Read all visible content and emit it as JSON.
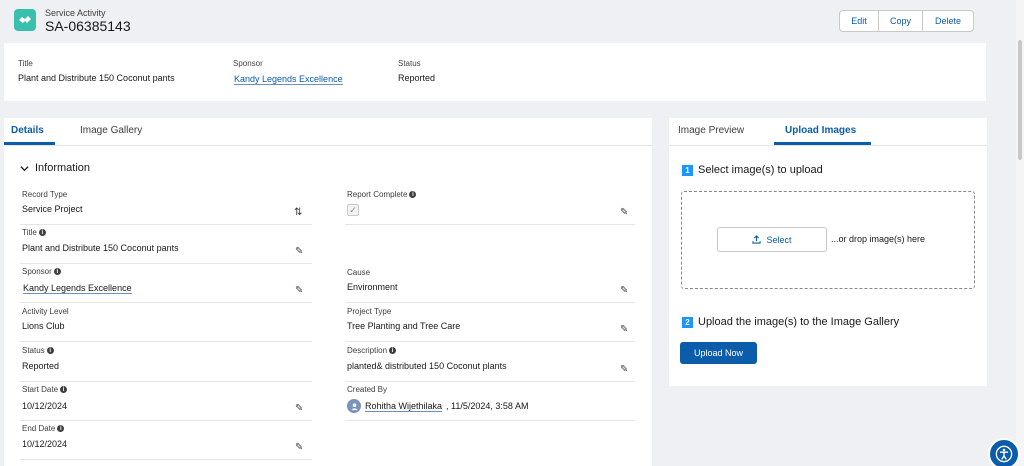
{
  "header": {
    "object_label": "Service Activity",
    "record_name": "SA-06385143",
    "icon": "service-activity-icon",
    "actions": [
      "Edit",
      "Copy",
      "Delete"
    ]
  },
  "highlights": {
    "fields": [
      {
        "label": "Title",
        "value": "Plant and Distribute 150 Coconut pants"
      },
      {
        "label": "Sponsor",
        "value": "Kandy Legends Excellence"
      },
      {
        "label": "Status",
        "value": "Reported"
      }
    ]
  },
  "detail_tabs": [
    "Details",
    "Image Gallery"
  ],
  "section": {
    "title": "Information",
    "left_fields": [
      {
        "label": "Record Type",
        "value": "Service Project"
      },
      {
        "label": "Title",
        "value": "Plant and Distribute 150 Coconut pants"
      },
      {
        "label": "Sponsor",
        "value": "Kandy Legends Excellence"
      },
      {
        "label": "Activity Level",
        "value": "Lions Club"
      },
      {
        "label": "Status",
        "value": "Reported"
      },
      {
        "label": "Start Date",
        "value": "10/12/2024"
      },
      {
        "label": "End Date",
        "value": "10/12/2024"
      }
    ],
    "right_fields": [
      {
        "label": "Report Complete",
        "value": ""
      },
      {
        "label": "Cause",
        "value": "Environment"
      },
      {
        "label": "Project Type",
        "value": "Tree Planting and Tree Care"
      },
      {
        "label": "Description",
        "value": "planted& distributed 150 Coconut plants"
      },
      {
        "label": "Created By",
        "user": "Rohitha Wijethilaka",
        "date": ", 11/5/2024, 3:58 AM"
      }
    ]
  },
  "image_panel": {
    "tabs": [
      "Image Preview",
      "Upload Images"
    ],
    "step1": {
      "num": "1",
      "text": "Select image(s) to upload"
    },
    "select_label": "Select",
    "drop_hint": "...or drop image(s) here",
    "step2": {
      "num": "2",
      "text": "Upload the image(s) to the Image Gallery"
    },
    "upload_label": "Upload Now"
  },
  "colors": {
    "brand": "#0b5cab",
    "icon_teal": "#3bbfad",
    "step_blue": "#1b96ff"
  }
}
